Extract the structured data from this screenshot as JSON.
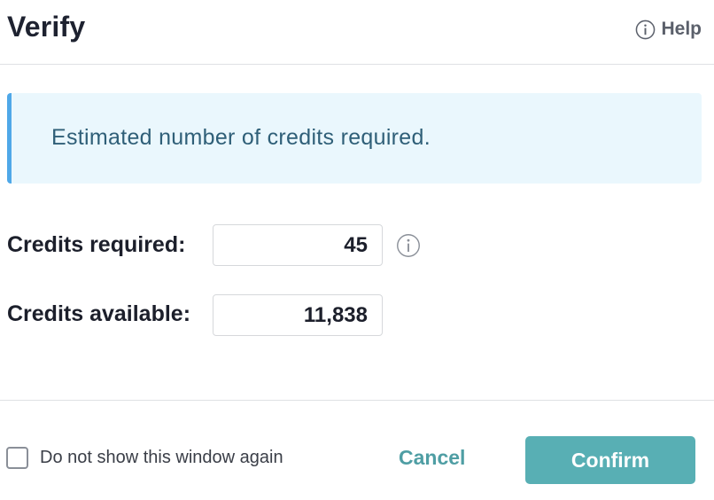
{
  "header": {
    "title": "Verify",
    "help_label": "Help",
    "help_icon": "info-circle-icon"
  },
  "banner": {
    "text": "Estimated number of credits required.",
    "accent_color": "#4fa8e8",
    "background_color": "#eaf7fd"
  },
  "fields": {
    "required": {
      "label": "Credits required:",
      "value": "45",
      "tip_icon": "info-circle-icon"
    },
    "available": {
      "label": "Credits available:",
      "value": "11,838"
    }
  },
  "footer": {
    "checkbox_label": "Do not show this window again",
    "checkbox_checked": false,
    "cancel_label": "Cancel",
    "confirm_label": "Confirm",
    "confirm_color": "#58afb4"
  }
}
